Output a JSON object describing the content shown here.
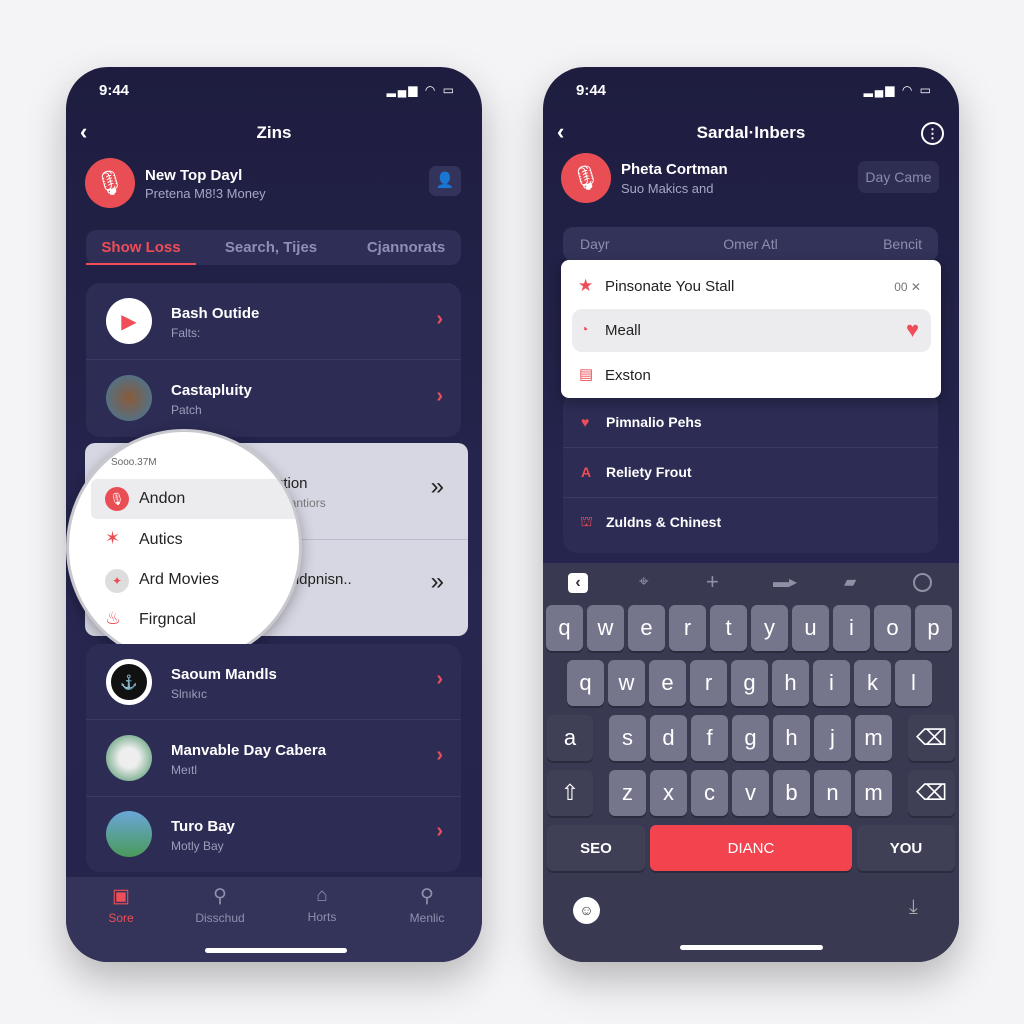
{
  "left": {
    "time": "9:44",
    "status_icons": "signal-wifi-battery",
    "title": "Zins",
    "profile": {
      "name": "New Top Dayl",
      "subtitle": "Pretena M8!3 Money"
    },
    "tabs": [
      {
        "label": "Show Loss",
        "active": true
      },
      {
        "label": "Search, Tijes"
      },
      {
        "label": "Cjannorats"
      }
    ],
    "list1": [
      {
        "title": "Bash Outide",
        "subtitle": "Falts:",
        "icon": "play-icon"
      },
      {
        "title": "Castapluity",
        "subtitle": "Patch",
        "icon": "thumbnail"
      }
    ],
    "overlay_rows": [
      {
        "title": "ution",
        "subtitle": "eillantiors"
      },
      {
        "title": "s Aldpnisn..",
        "subtitle": ""
      }
    ],
    "magnifier": {
      "header": "Sooo.37M",
      "items": [
        {
          "label": "Andon",
          "icon": "mic-icon",
          "selected": true
        },
        {
          "label": "Autics",
          "icon": "star-icon"
        },
        {
          "label": "Ard Movies",
          "icon": "figure-icon"
        },
        {
          "label": "Firgncal",
          "icon": "flame-icon"
        }
      ]
    },
    "list2": [
      {
        "title": "Saoum Mandls",
        "subtitle": "Slnıkıc",
        "icon": "anchor-icon"
      },
      {
        "title": "Manvable Day Cabera",
        "subtitle": "Meıtl",
        "icon": "thumbnail"
      },
      {
        "title": "Turo Bay",
        "subtitle": "Motly Bay",
        "icon": "thumbnail"
      }
    ],
    "tabbar": [
      {
        "label": "Sore",
        "icon": "store-icon",
        "active": true
      },
      {
        "label": "Disschud",
        "icon": "search-icon"
      },
      {
        "label": "Horts",
        "icon": "bag-icon"
      },
      {
        "label": "Menlic",
        "icon": "zoom-icon"
      }
    ]
  },
  "right": {
    "time": "9:44",
    "title": "Sardal·Inbers",
    "profile": {
      "name": "Pheta Cortman",
      "subtitle": "Suo Makics and",
      "button": "Day Came"
    },
    "segments": [
      "Dayr",
      "Omer Atl",
      "Bencit"
    ],
    "popup": [
      {
        "label": "Pinsonate You Stall",
        "trailing": "00 ✕",
        "icon": "star-icon"
      },
      {
        "label": "Meall",
        "icon": "timer-icon",
        "selected": true,
        "trailing_icon": "heart-icon"
      },
      {
        "label": "Exston",
        "icon": "calendar-icon"
      }
    ],
    "list": [
      {
        "label": "Pimnalio Pehs",
        "icon": "heart-icon"
      },
      {
        "label": "Reliety Frout",
        "icon": "a-icon"
      },
      {
        "label": "Zuldns & Chinest",
        "icon": "figures-icon"
      }
    ],
    "keyboard": {
      "rows": [
        [
          "q",
          "w",
          "e",
          "r",
          "t",
          "y",
          "u",
          "i",
          "o",
          "p"
        ],
        [
          "q",
          "w",
          "e",
          "r",
          "g",
          "h",
          "i",
          "k",
          "l"
        ],
        [
          "a",
          "s",
          "d",
          "f",
          "g",
          "h",
          "j",
          "m",
          "⌫"
        ],
        [
          "⇧",
          "z",
          "x",
          "c",
          "v",
          "b",
          "n",
          "m",
          "⌫"
        ]
      ],
      "bottom": {
        "left": "SEO",
        "center": "DIANC",
        "right": "YOU"
      }
    },
    "colors": {
      "accent": "#f2434f"
    }
  }
}
